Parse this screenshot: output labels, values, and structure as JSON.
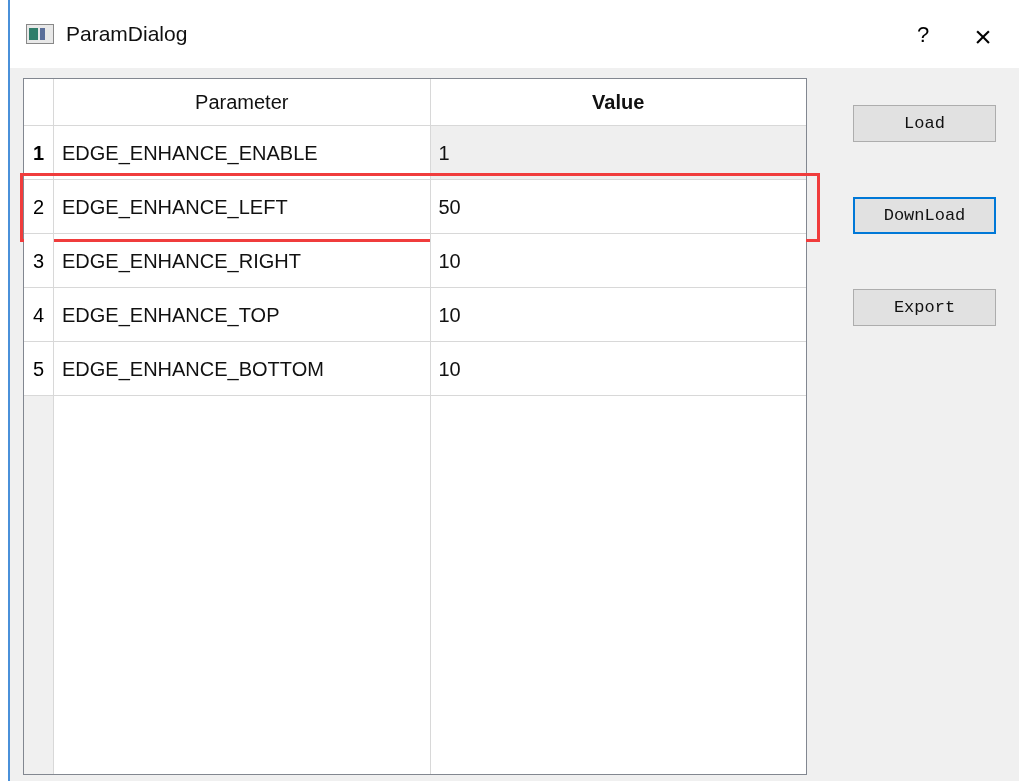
{
  "window": {
    "title": "ParamDialog",
    "help_button": "?",
    "close_button": "×"
  },
  "table": {
    "columns": [
      {
        "label": "Parameter",
        "current": false
      },
      {
        "label": "Value",
        "current": true
      }
    ],
    "rows": [
      {
        "number": "1",
        "parameter": "EDGE_ENHANCE_ENABLE",
        "value": "1",
        "current": true,
        "highlighted": false
      },
      {
        "number": "2",
        "parameter": "EDGE_ENHANCE_LEFT",
        "value": "50",
        "current": false,
        "highlighted": true
      },
      {
        "number": "3",
        "parameter": "EDGE_ENHANCE_RIGHT",
        "value": "10",
        "current": false,
        "highlighted": false
      },
      {
        "number": "4",
        "parameter": "EDGE_ENHANCE_TOP",
        "value": "10",
        "current": false,
        "highlighted": false
      },
      {
        "number": "5",
        "parameter": "EDGE_ENHANCE_BOTTOM",
        "value": "10",
        "current": false,
        "highlighted": false
      }
    ]
  },
  "buttons": [
    {
      "label": "Load",
      "focused": false
    },
    {
      "label": "DownLoad",
      "focused": true
    },
    {
      "label": "Export",
      "focused": false
    }
  ]
}
